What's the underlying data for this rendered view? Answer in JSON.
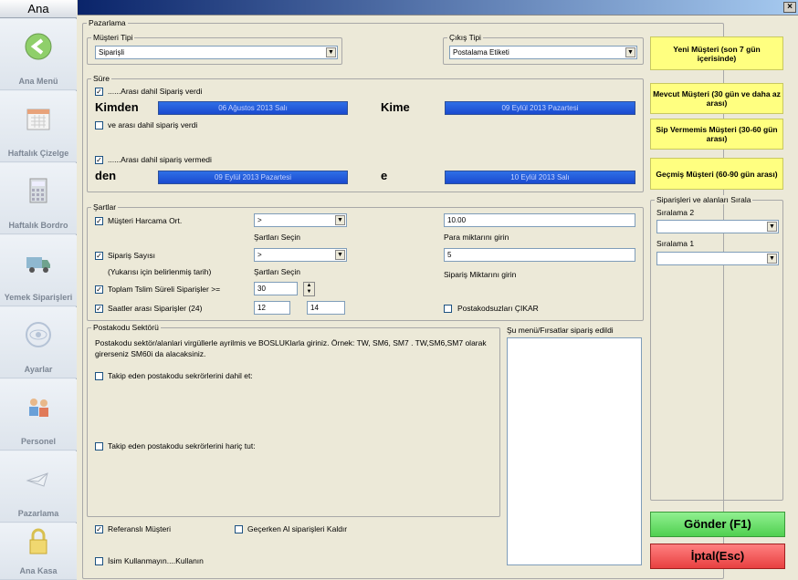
{
  "sidebar": {
    "title": "Ana",
    "items": [
      {
        "label": "Ana Menü",
        "icon": "back-arrow-icon"
      },
      {
        "label": "Haftalık Çizelge",
        "icon": "calendar-icon"
      },
      {
        "label": "Haftalık Bordro",
        "icon": "calculator-icon"
      },
      {
        "label": "Yemek Siparişleri",
        "icon": "delivery-truck-icon"
      },
      {
        "label": "Ayarlar",
        "icon": "settings-icon"
      },
      {
        "label": "Personel",
        "icon": "people-icon"
      },
      {
        "label": "Pazarlama",
        "icon": "envelope-icon"
      },
      {
        "label": "Ana Kasa",
        "icon": "padlock-icon"
      }
    ]
  },
  "window": {
    "close": "×"
  },
  "pazarlama": {
    "title": "Pazarlama"
  },
  "musteri": {
    "title": "Müşteri Tipi",
    "value": "Siparişli"
  },
  "cikis": {
    "title": "Çıkış Tipi",
    "value": "Postalama Etiketi"
  },
  "sure": {
    "title": "Süre",
    "cb1": "......Arası dahil Sipariş verdi",
    "kimden": "Kimden",
    "date1": "06 Ağustos 2013 Salı",
    "kime": "Kime",
    "date2": "09 Eylül 2013 Pazartesi",
    "cb2": "ve arası dahil sipariş verdi",
    "cb3": "......Arası dahil sipariş vermedi",
    "den": "den",
    "date3": "09 Eylül 2013 Pazartesi",
    "e": "e",
    "date4": "10 Eylül 2013 Salı"
  },
  "sartlar": {
    "title": "Şartlar",
    "harcama": "Müşteri Harcama Ort.",
    "op1": ">",
    "sec1": "Şartları Seçin",
    "para": "10.00",
    "paralbl": "Para miktarını girin",
    "sayisi": "Sipariş Sayısı",
    "op2": ">",
    "yukarisi": "(Yukarısı için belirlenmiş tarih)",
    "sec2": "Şartları Seçin",
    "siparis": "5",
    "siparislbl": "Sipariş Miktarını girin",
    "toplam": "Toplam Tslim Süreli Siparişler >=",
    "toplamval": "30",
    "saatler": "Saatler arası Siparişler (24)",
    "saat1": "12",
    "saat2": "14",
    "posta": "Postakodsuzları ÇIKAR"
  },
  "postakodu": {
    "title": "Postakodu Sektörü",
    "desc": "Postakodu sektör/alanlari virgüllerle ayrilmis ve BOSLUKlarla giriniz. Örnek: TW, SM6, SM7 . TW,SM6,SM7 olarak girerseniz SM60i da alacaksiniz.",
    "dahil": "Takip eden postakodu sekrörlerini dahil et:",
    "haric": "Takip eden postakodu sekrörlerini hariç tut:"
  },
  "menu": {
    "title": "Şu menü/Fırsatlar sipariş edildi"
  },
  "bottom": {
    "ref": "Referanslı Müşteri",
    "gecerken": "Geçerken Al siparişleri Kaldır",
    "isim": "İsim Kullanmayın....Kullanın"
  },
  "right": {
    "btn1": "Yeni Müşteri (son 7 gün içerisinde)",
    "btn2": "Mevcut Müşteri (30 gün ve daha az arası)",
    "btn3": "Sip Vermemis Müşteri (30-60 gün arası)",
    "btn4": "Geçmiş Müşteri (60-90 gün arası)",
    "sort": "Siparişleri ve alanları Sırala",
    "s2": "Sıralama 2",
    "s1": "Sıralama 1",
    "send": "Gönder (F1)",
    "cancel": "İptal(Esc)"
  }
}
